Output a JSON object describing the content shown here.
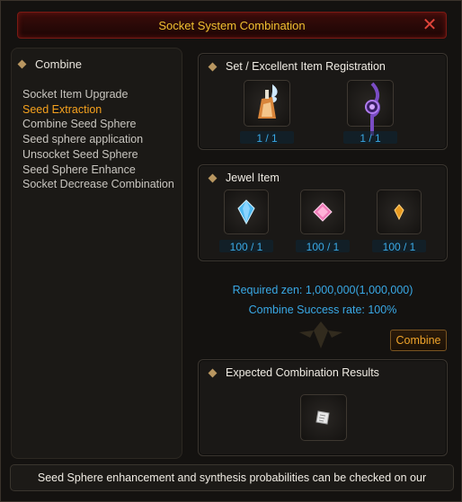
{
  "window": {
    "title": "Socket System Combination",
    "close_label": "✕"
  },
  "sidebar": {
    "header": "Combine",
    "items": [
      {
        "label": "Socket Item Upgrade",
        "active": false
      },
      {
        "label": "Seed Extraction",
        "active": true
      },
      {
        "label": "Combine Seed Sphere",
        "active": false
      },
      {
        "label": "Seed sphere application",
        "active": false
      },
      {
        "label": "Unsocket Seed Sphere",
        "active": false
      },
      {
        "label": "Seed Sphere Enhance",
        "active": false
      },
      {
        "label": "Socket Decrease Combination",
        "active": false
      }
    ]
  },
  "registration": {
    "header": "Set / Excellent Item Registration",
    "slots": [
      {
        "icon": "armor-item-icon",
        "count": "1 / 1"
      },
      {
        "icon": "staff-item-icon",
        "count": "1 / 1"
      }
    ]
  },
  "jewels": {
    "header": "Jewel Item",
    "slots": [
      {
        "icon": "blue-jewel-icon",
        "count": "100 / 1"
      },
      {
        "icon": "pink-jewel-icon",
        "count": "100 / 1"
      },
      {
        "icon": "orange-jewel-icon",
        "count": "100 / 1"
      }
    ]
  },
  "info": {
    "required_zen": "Required zen: 1,000,000(1,000,000)",
    "success_rate": "Combine Success rate: 100%"
  },
  "combine_button": "Combine",
  "results": {
    "header": "Expected Combination Results",
    "slot_icon": "seed-result-icon"
  },
  "footer": {
    "text": "Seed Sphere enhancement and synthesis probabilities can be checked on our"
  },
  "colors": {
    "title": "#f0c030",
    "active_menu": "#f6a21e",
    "info_blue": "#39a9e6",
    "button_text": "#f0a42a"
  }
}
